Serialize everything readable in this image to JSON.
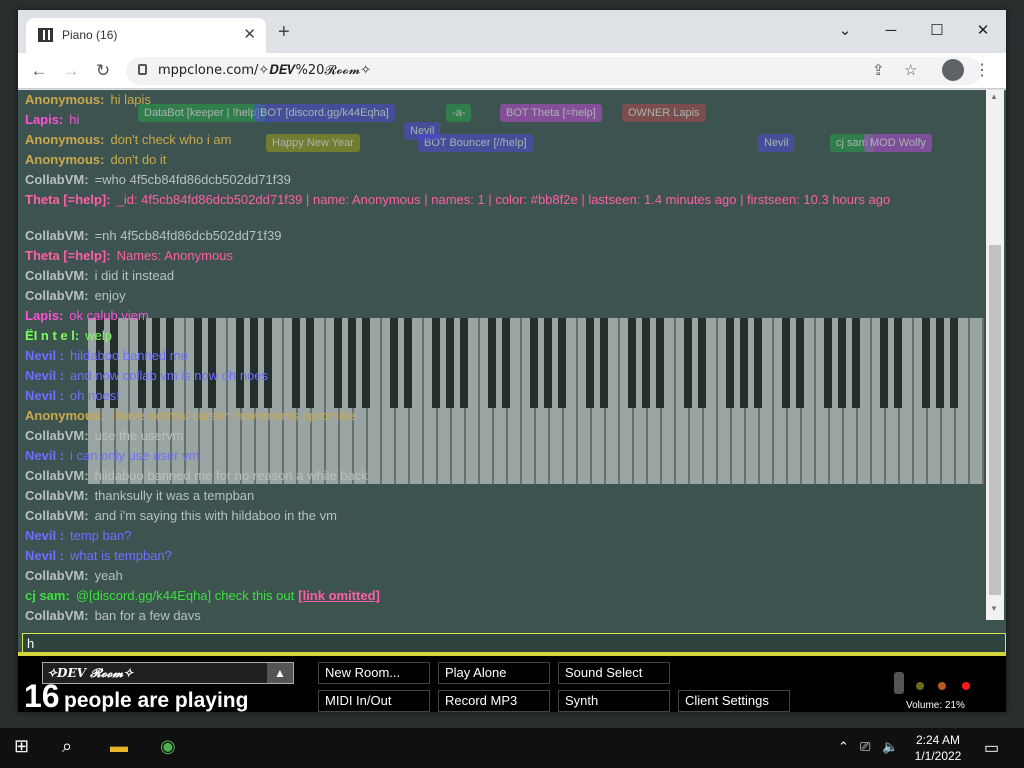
{
  "browser": {
    "tab_title": "Piano (16)",
    "url": "mppclone.com/✧𝑫𝑬𝑽%20𝓡𝓸𝓸𝓶✧"
  },
  "chat": {
    "lines": [
      {
        "name": "Anonymous:",
        "text": "hi lapis",
        "color": "#c9a94b"
      },
      {
        "name": "Lapis:",
        "text": "hi",
        "color": "#ff4fd6"
      },
      {
        "name": "Anonymous:",
        "text": "don't check who i am",
        "color": "#c9a94b"
      },
      {
        "name": "Anonymous:",
        "text": "don't do it",
        "color": "#c9a94b"
      },
      {
        "name": "CollabVM:",
        "text": "=who 4f5cb84fd86dcb502dd71f39",
        "color": "#b9c0bf"
      },
      {
        "name": "Theta [=help]:",
        "text": "_id: 4f5cb84fd86dcb502dd71f39 | name: Anonymous | names: 1 | color: #bb8f2e | lastseen: 1.4 minutes ago | firstseen: 10.3 hours ago",
        "color": "#ff5fa2",
        "wrap": true
      },
      {
        "name": "CollabVM:",
        "text": "=nh 4f5cb84fd86dcb502dd71f39",
        "color": "#b9c0bf"
      },
      {
        "name": "Theta [=help]:",
        "text": "Names: Anonymous",
        "color": "#ff5fa2"
      },
      {
        "name": "CollabVM:",
        "text": "i did it instead",
        "color": "#b9c0bf"
      },
      {
        "name": "CollabVM:",
        "text": "enjoy",
        "color": "#b9c0bf"
      },
      {
        "name": "Lapis:",
        "text": "ok calub viem",
        "color": "#ff4fd6"
      },
      {
        "name": "ЁI n t e l:",
        "text": "welp",
        "color": "#7cff5a"
      },
      {
        "name": "Nevil :",
        "text": "hildaboo banned me",
        "color": "#6f6fff"
      },
      {
        "name": "Nevil :",
        "text": "and now collab vm is now oh noes",
        "color": "#6f6fff"
      },
      {
        "name": "Nevil :",
        "text": "oh noes!",
        "color": "#6f6fff"
      },
      {
        "name": "Anonymous:",
        "text": "i have normal cursor movements i promise",
        "color": "#c9a94b"
      },
      {
        "name": "CollabVM:",
        "text": "use the uservm",
        "color": "#b9c0bf"
      },
      {
        "name": "Nevil :",
        "text": "i can only use user vm",
        "color": "#6f6fff"
      },
      {
        "name": "CollabVM:",
        "text": "hildaboo banned me for no reason a while back",
        "color": "#b9c0bf"
      },
      {
        "name": "CollabVM:",
        "text": "thanksully it was a tempban",
        "color": "#b9c0bf"
      },
      {
        "name": "CollabVM:",
        "text": "and i'm saying this with hildaboo in the vm",
        "color": "#b9c0bf"
      },
      {
        "name": "Nevil :",
        "text": "temp ban?",
        "color": "#6f6fff"
      },
      {
        "name": "Nevil :",
        "text": "what is tempban?",
        "color": "#6f6fff"
      },
      {
        "name": "CollabVM:",
        "text": "yeah",
        "color": "#b9c0bf"
      },
      {
        "name": "cj sam:",
        "text": "@[discord.gg/k44Eqha] check this out",
        "color": "#3ee03e",
        "link": "[link omitted]"
      },
      {
        "name": "CollabVM:",
        "text": "ban for a few days",
        "color": "#b9c0bf"
      }
    ],
    "input_value": "h"
  },
  "overlay_tags": [
    {
      "text": "DataBot [keeper | !help]",
      "color": "#2aa04a"
    },
    {
      "text": "BOT [discord.gg/k44Eqha]",
      "color": "#4b4bd6"
    },
    {
      "text": "-a-",
      "color": "#2aa04a"
    },
    {
      "text": "BOT Theta [=help]",
      "color": "#c24bd6"
    },
    {
      "text": "OWNER Lapis",
      "color": "#b04b4b"
    },
    {
      "text": "Happy New Year",
      "color": "#a0a01a"
    },
    {
      "text": "BOT Bouncer [//help]",
      "color": "#4b4bd6"
    },
    {
      "text": "Nevil",
      "color": "#4b4bd6"
    },
    {
      "text": "cj sam",
      "color": "#2aa04a"
    },
    {
      "text": "MOD Wolfy",
      "color": "#b44bd6"
    },
    {
      "text": "Nevil",
      "color": "#4b4bd6"
    }
  ],
  "controls": {
    "room": "✧𝑫𝑬𝑽 𝓡𝓸𝓸𝓶✧",
    "player_count": "16",
    "player_text": "people are playing",
    "buttons": [
      "New Room...",
      "Play Alone",
      "Sound Select",
      "MIDI In/Out",
      "Record MP3",
      "Synth",
      "Client Settings"
    ],
    "volume": "Volume: 21%"
  },
  "taskbar": {
    "time": "2:24 AM",
    "date": "1/1/2022"
  }
}
